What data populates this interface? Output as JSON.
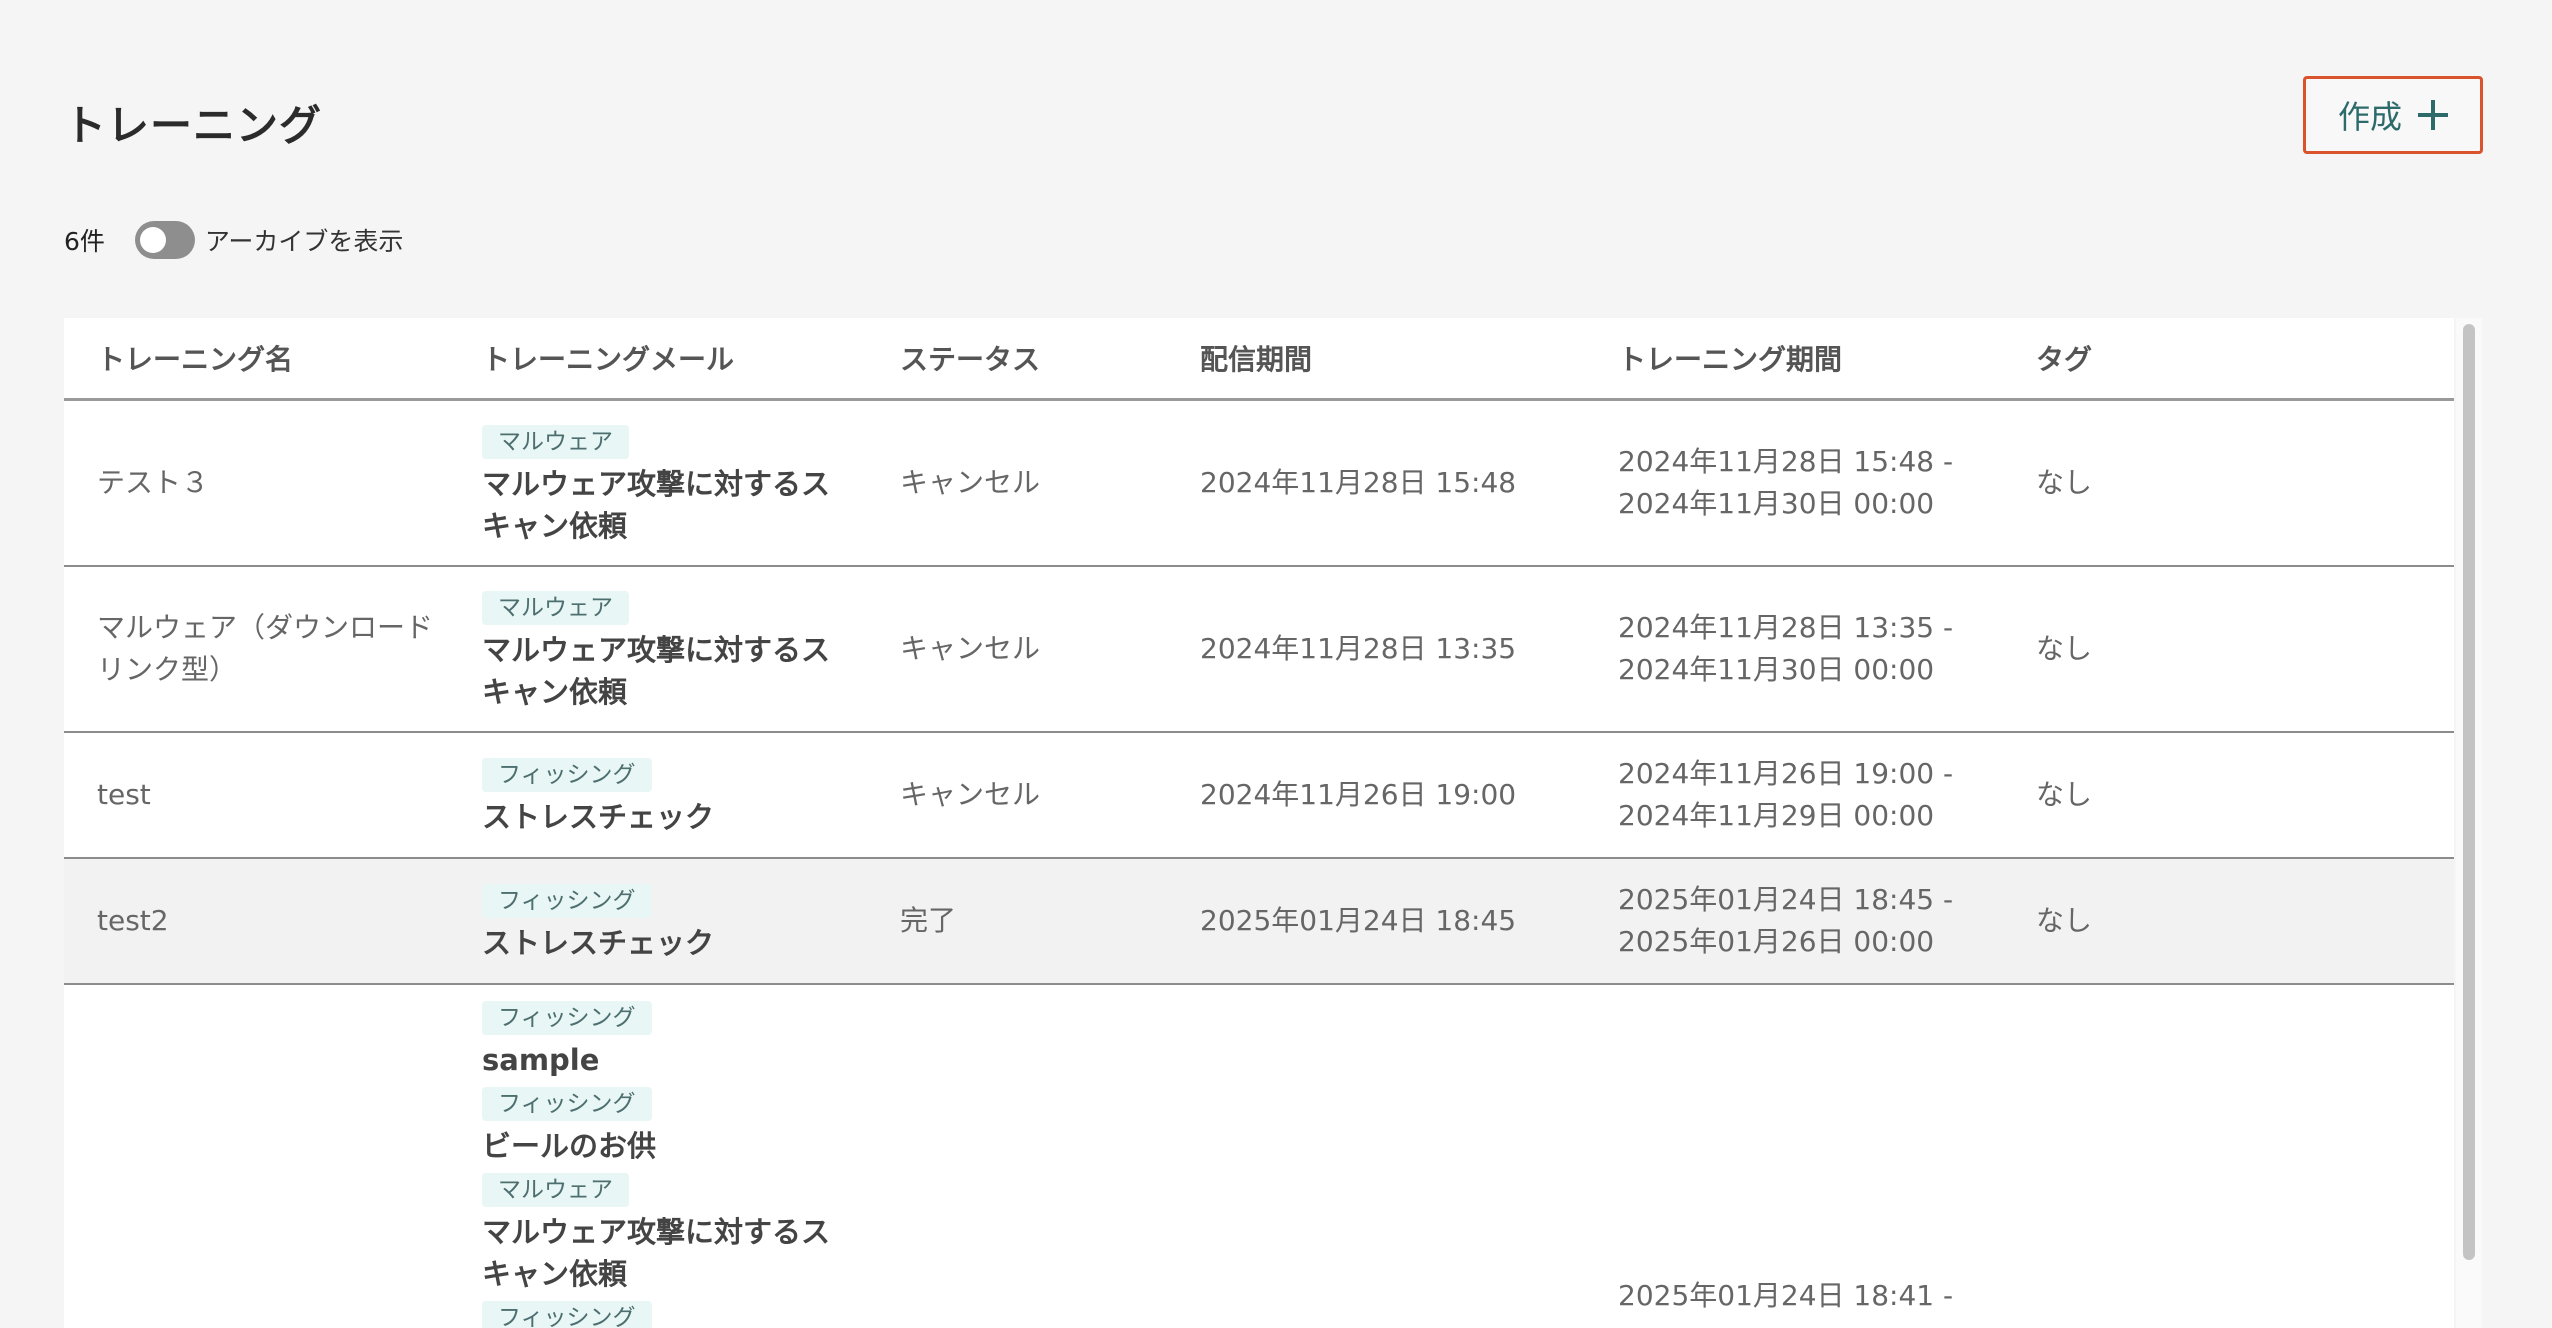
{
  "page": {
    "title": "トレーニング",
    "create_label": "作成"
  },
  "filters": {
    "count": "6件",
    "archive_label": "アーカイブを表示",
    "archive_on": false
  },
  "table": {
    "headers": [
      "トレーニング名",
      "トレーニングメール",
      "ステータス",
      "配信期間",
      "トレーニング期間",
      "タグ"
    ],
    "rows": [
      {
        "name": "テスト３",
        "mails": [
          {
            "badge": "マルウェア",
            "title": "マルウェア攻撃に対するスキャン依頼"
          }
        ],
        "status": "キャンセル",
        "distribution": "2024年11月28日 15:48",
        "period_start": "2024年11月28日 15:48 -",
        "period_end": "2024年11月30日 00:00",
        "tag": "なし"
      },
      {
        "name": "マルウェア（ダウンロードリンク型）",
        "mails": [
          {
            "badge": "マルウェア",
            "title": "マルウェア攻撃に対するスキャン依頼"
          }
        ],
        "status": "キャンセル",
        "distribution": "2024年11月28日 13:35",
        "period_start": "2024年11月28日 13:35 -",
        "period_end": "2024年11月30日 00:00",
        "tag": "なし"
      },
      {
        "name": "test",
        "mails": [
          {
            "badge": "フィッシング",
            "title": "ストレスチェック"
          }
        ],
        "status": "キャンセル",
        "distribution": "2024年11月26日 19:00",
        "period_start": "2024年11月26日 19:00 -",
        "period_end": "2024年11月29日 00:00",
        "tag": "なし"
      },
      {
        "name": "test2",
        "mails": [
          {
            "badge": "フィッシング",
            "title": "ストレスチェック"
          }
        ],
        "status": "完了",
        "distribution": "2025年01月24日 18:45",
        "period_start": "2025年01月24日 18:45 -",
        "period_end": "2025年01月26日 00:00",
        "tag": "なし",
        "highlighted": true
      },
      {
        "name": "",
        "mails": [
          {
            "badge": "フィッシング",
            "title": "sample"
          },
          {
            "badge": "フィッシング",
            "title": "ビールのお供"
          },
          {
            "badge": "マルウェア",
            "title": "マルウェア攻撃に対するスキャン依頼"
          },
          {
            "badge": "フィッシング",
            "title": ""
          }
        ],
        "status": "",
        "distribution": "",
        "period_start": "2025年01月24日 18:41 -",
        "period_end": "",
        "tag": ""
      }
    ]
  },
  "icons": {
    "create": "plus-icon"
  },
  "colors": {
    "accent": "#2d6b6b",
    "focus_border": "#d9532c",
    "badge_bg": "#e9f6f6"
  }
}
